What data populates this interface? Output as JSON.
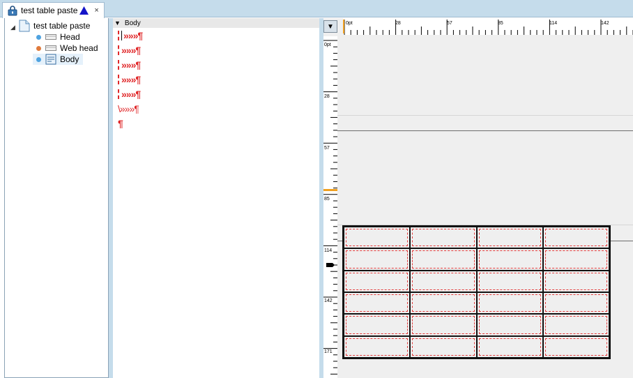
{
  "tab": {
    "title": "test table paste",
    "close_label": "×"
  },
  "tree": {
    "root": {
      "label": "test table paste",
      "icon": "document-icon"
    },
    "children": [
      {
        "label": "Head",
        "icon": "head-section-icon",
        "dot_color": "#4fa3e0"
      },
      {
        "label": "Web head",
        "icon": "web-head-section-icon",
        "dot_color": "#e07a3c"
      },
      {
        "label": "Body",
        "icon": "body-section-icon",
        "dot_color": "#4fa3e0",
        "selected": true
      }
    ]
  },
  "body_panel": {
    "header": "Body",
    "lines": [
      {
        "marker": "dashed-bar",
        "text": "»»»¶",
        "caret": true
      },
      {
        "marker": "dashed-bar",
        "text": "»»»¶"
      },
      {
        "marker": "dashed-bar",
        "text": "»»»¶"
      },
      {
        "marker": "dashed-bar",
        "text": "»»»¶"
      },
      {
        "marker": "dashed-bar",
        "text": "»»»¶"
      },
      {
        "marker": "backslash",
        "text": "\\»»»¶"
      },
      {
        "marker": "none",
        "text": "¶"
      }
    ]
  },
  "ruler": {
    "h_labels": [
      "0pt",
      "28",
      "57",
      "85",
      "114",
      "142"
    ],
    "v_labels": [
      "0pt",
      "28",
      "57",
      "85",
      "114",
      "142",
      "171"
    ]
  },
  "table": {
    "rows": 6,
    "cols": 4
  },
  "colors": {
    "accent": "#c5dceb",
    "mark_red": "#e0282a",
    "ruler_marker": "#f0a020"
  }
}
